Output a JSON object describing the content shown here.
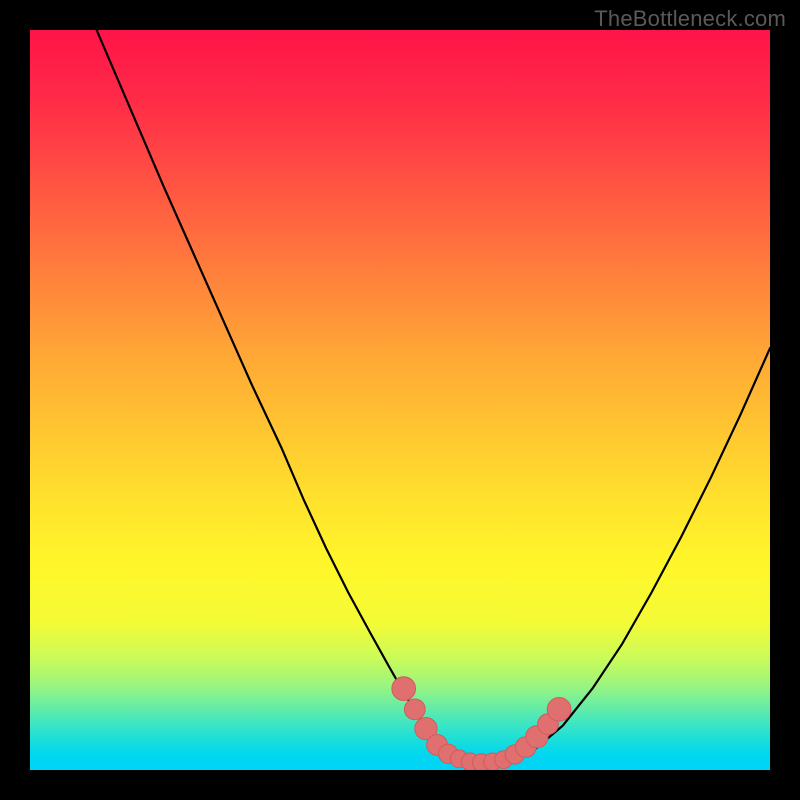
{
  "watermark": "TheBottleneck.com",
  "colors": {
    "background_frame": "#000000",
    "curve_stroke": "#000000",
    "marker_fill": "#e07070",
    "watermark_text": "#5a5a5a"
  },
  "chart_data": {
    "type": "line",
    "title": "",
    "xlabel": "",
    "ylabel": "",
    "xlim": [
      0,
      100
    ],
    "ylim": [
      0,
      100
    ],
    "grid": false,
    "legend": false,
    "annotations": [
      "TheBottleneck.com"
    ],
    "series": [
      {
        "name": "bottleneck-curve",
        "x": [
          9,
          12,
          15,
          18,
          22,
          26,
          30,
          34,
          37,
          40,
          43,
          46,
          48.5,
          50.5,
          52,
          54,
          56,
          58,
          60,
          62,
          64,
          66,
          68,
          72,
          76,
          80,
          84,
          88,
          92,
          96,
          100
        ],
        "y": [
          100,
          93,
          86,
          79,
          70,
          61,
          52,
          43.5,
          36.5,
          30,
          24,
          18.5,
          14,
          10.5,
          8,
          5.5,
          3.5,
          2.3,
          1.5,
          1.1,
          1.1,
          1.6,
          2.6,
          6,
          11,
          17,
          24,
          31.5,
          39.5,
          48,
          57
        ]
      }
    ],
    "markers": [
      {
        "x": 50.5,
        "y": 11,
        "r": 1.6
      },
      {
        "x": 52,
        "y": 8.2,
        "r": 1.4
      },
      {
        "x": 53.5,
        "y": 5.6,
        "r": 1.5
      },
      {
        "x": 55,
        "y": 3.4,
        "r": 1.4
      },
      {
        "x": 56.5,
        "y": 2.2,
        "r": 1.3
      },
      {
        "x": 58,
        "y": 1.5,
        "r": 1.2
      },
      {
        "x": 59.5,
        "y": 1.1,
        "r": 1.2
      },
      {
        "x": 61,
        "y": 1.0,
        "r": 1.2
      },
      {
        "x": 62.5,
        "y": 1.1,
        "r": 1.2
      },
      {
        "x": 64,
        "y": 1.4,
        "r": 1.2
      },
      {
        "x": 65.5,
        "y": 2.1,
        "r": 1.3
      },
      {
        "x": 67,
        "y": 3.1,
        "r": 1.4
      },
      {
        "x": 68.5,
        "y": 4.5,
        "r": 1.5
      },
      {
        "x": 70,
        "y": 6.2,
        "r": 1.4
      },
      {
        "x": 71.5,
        "y": 8.2,
        "r": 1.6
      }
    ],
    "note": "Axis values are in 0-100 normalized units (percent of plot width/height). y=0 is the bottom of the gradient area; y=100 is the top. Values were estimated visually from the raster image since the chart has no tick labels."
  }
}
